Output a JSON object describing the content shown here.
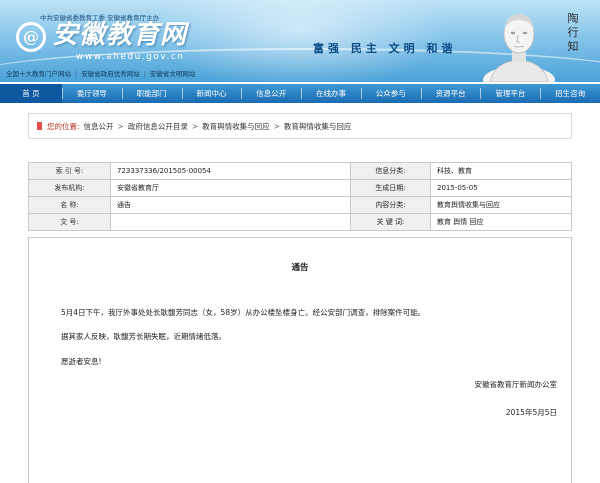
{
  "header": {
    "sponsor": "中共安徽省委教育工委  安徽省教育厅主办",
    "logo_symbol": "@",
    "logo_text": "安徽教育网",
    "logo_url": "www.ahedu.gov.cn",
    "slogan": "富强  民主  文明  和谐",
    "signature": "陶行知",
    "quick_links": [
      "全国十大教育门户网站",
      "安徽省政府优秀网站",
      "安徽省文明网站"
    ]
  },
  "nav": {
    "items": [
      "首  页",
      "委厅领导",
      "职能部门",
      "新闻中心",
      "信息公开",
      "在线办事",
      "公众参与",
      "资源平台",
      "管理平台",
      "招生咨询"
    ]
  },
  "breadcrumb": {
    "label": "您的位置:",
    "items": [
      "信息公开",
      "政府信息公开目录",
      "教育舆情收集与回应",
      "教育舆情收集与回应"
    ]
  },
  "meta": {
    "index_label": "索 引 号:",
    "index_value": "723337336/201505-00054",
    "category_label": "信息分类:",
    "category_value": "科技、教育",
    "publisher_label": "发布机构:",
    "publisher_value": "安徽省教育厅",
    "date_label": "生成日期:",
    "date_value": "2015-05-05",
    "name_label": "名      称:",
    "name_value": "通告",
    "content_cat_label": "内容分类:",
    "content_cat_value": "教育舆情收集与回应",
    "docno_label": "文      号:",
    "docno_value": "",
    "keywords_label": "关 键 词:",
    "keywords_value": "教育 舆情 回应"
  },
  "notice": {
    "title": "通告",
    "para1": "5月4日下午，我厅外事处处长耿馥芳同志（女，58岁）从办公楼坠楼身亡。经公安部门调查，排除案件可能。",
    "para2": "据其家人反映，耿馥芳长期失眠，近期情绪低落。",
    "para3": "愿逝者安息!",
    "signature_org": "安徽省教育厅新闻办公室",
    "signature_date": "2015年5月5日"
  }
}
